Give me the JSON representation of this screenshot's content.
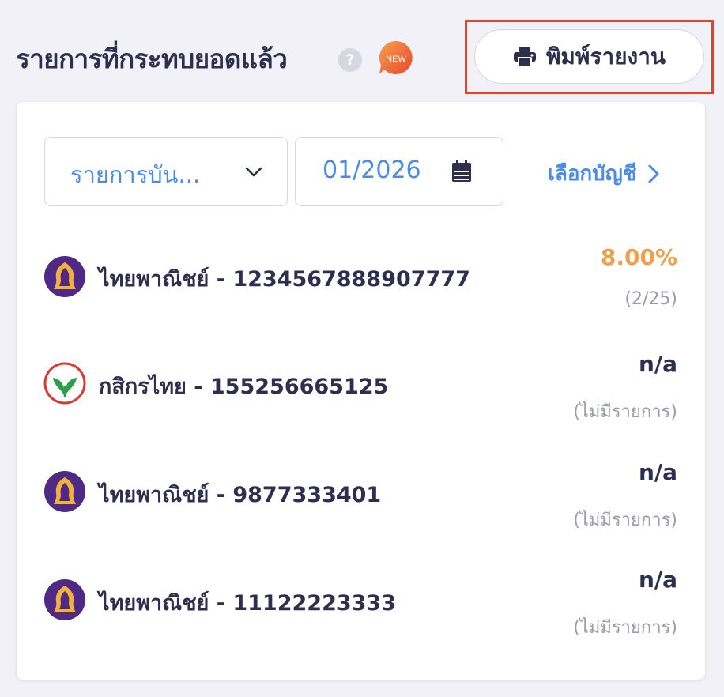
{
  "header": {
    "title": "รายการที่กระทบยอดแล้ว",
    "help_icon": "?",
    "badge": "NEW",
    "print_button_label": "พิมพ์รายงาน"
  },
  "filters": {
    "type_select_value": "รายการบัน...",
    "date_value": "01/2026",
    "select_account_label": "เลือกบัญชี"
  },
  "accounts": [
    {
      "bank": "scb",
      "name": "ไทยพาณิชย์ - 1234567888907777",
      "value": "8.00%",
      "sub": "(2/25)",
      "value_color": "#f0a04a"
    },
    {
      "bank": "kbank",
      "name": "กสิกรไทย - 155256665125",
      "value": "n/a",
      "sub": "(ไม่มีรายการ)",
      "value_color": "#2e2e4f"
    },
    {
      "bank": "scb",
      "name": "ไทยพาณิชย์ - 9877333401",
      "value": "n/a",
      "sub": "(ไม่มีรายการ)",
      "value_color": "#2e2e4f"
    },
    {
      "bank": "scb",
      "name": "ไทยพาณิชย์ - 11122223333",
      "value": "n/a",
      "sub": "(ไม่มีรายการ)",
      "value_color": "#2e2e4f"
    }
  ],
  "icons": {
    "print": "printer-icon",
    "select": "chevron-down-icon",
    "date": "calendar-icon",
    "account": "chevron-right-icon",
    "scb_logo": "scb-logo-icon",
    "kbank_logo": "kbank-logo-icon"
  },
  "colors": {
    "accent": "#4a8be8",
    "highlight": "#e0442a",
    "percent": "#f0a04a",
    "text": "#2e2e4f",
    "muted": "#9a9aac",
    "scb_purple": "#4e2a84",
    "scb_gold": "#f2b03c",
    "kbank_green": "#2e9e4a",
    "kbank_red": "#d9372f"
  }
}
